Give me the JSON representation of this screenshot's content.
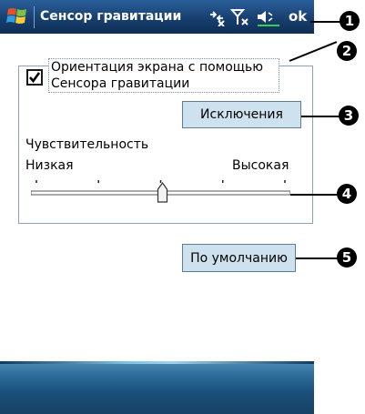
{
  "title_bar": {
    "title": "Сенсор гравитации",
    "ok_label": "ok",
    "icons": [
      "windows-start-icon",
      "connectivity-off-icon",
      "signal-off-icon",
      "volume-icon"
    ]
  },
  "gravity_sensor": {
    "checkbox_checked": true,
    "checkbox_label_line1": "Ориентация экрана с помощью",
    "checkbox_label_line2": "Сенсора гравитации",
    "exceptions_button": "Исключения",
    "sensitivity_label": "Чувствительность",
    "low_label": "Низкая",
    "high_label": "Высокая",
    "sensitivity_level": 0.5,
    "default_button": "По умолчанию"
  },
  "callouts": [
    "1",
    "2",
    "3",
    "4",
    "5"
  ],
  "colors": {
    "title_bar": "#17406f",
    "button_face": "#cde2ee",
    "group_border": "#8aa3bd"
  }
}
